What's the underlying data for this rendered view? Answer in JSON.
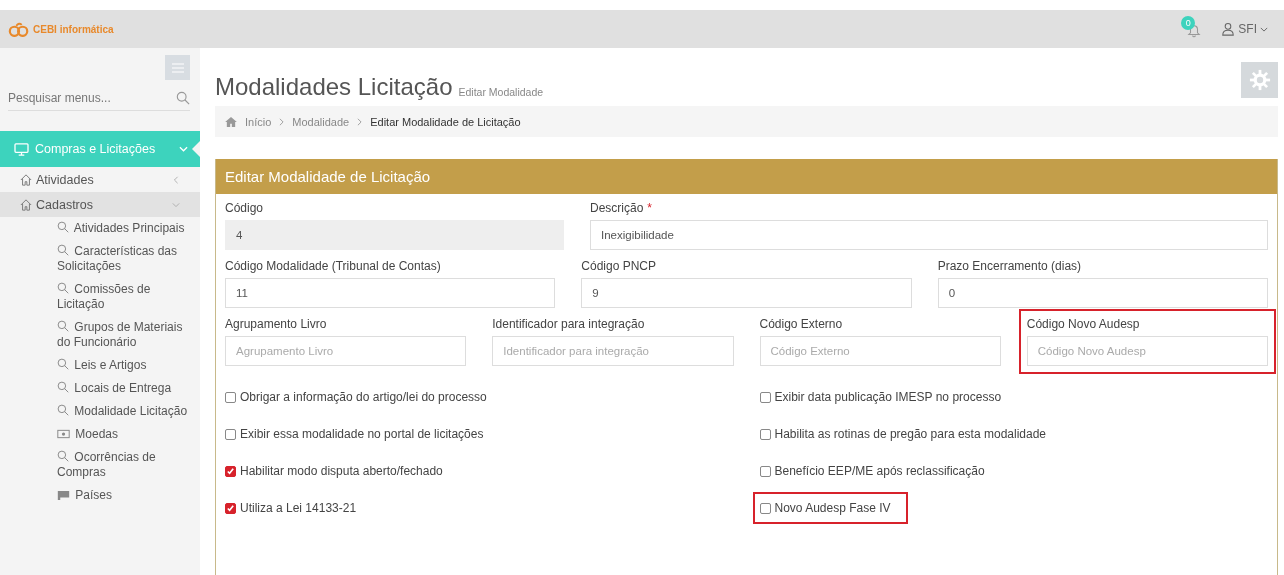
{
  "header": {
    "brand": "CEBI informática",
    "notifications": {
      "count": "0"
    },
    "user": {
      "name": "SFI"
    }
  },
  "sidebar": {
    "search": {
      "placeholder": "Pesquisar menus..."
    },
    "active_module": {
      "label": "Compras e Licitações",
      "expanded": true
    },
    "items": [
      {
        "label": "Atividades",
        "expanded": false,
        "selected": false
      },
      {
        "label": "Cadastros",
        "expanded": true,
        "selected": true,
        "children": [
          {
            "label": "Atividades Principais",
            "kind": "search"
          },
          {
            "label": "Características das Solicitações",
            "kind": "search"
          },
          {
            "label": "Comissões de Licitação",
            "kind": "search"
          },
          {
            "label": "Grupos de Materiais do Funcionário",
            "kind": "search"
          },
          {
            "label": "Leis e Artigos",
            "kind": "search"
          },
          {
            "label": "Locais de Entrega",
            "kind": "search"
          },
          {
            "label": "Modalidade Licitação",
            "kind": "search"
          },
          {
            "label": "Moedas",
            "kind": "cash"
          },
          {
            "label": "Ocorrências de Compras",
            "kind": "search"
          },
          {
            "label": "Países",
            "kind": "flag"
          }
        ]
      }
    ]
  },
  "page": {
    "title": "Modalidades Licitação",
    "subtitle": "Editar Modalidade",
    "breadcrumb": [
      "Início",
      "Modalidade",
      "Editar Modalidade de Licitação"
    ]
  },
  "panel": {
    "title": "Editar Modalidade de Licitação",
    "field_rows": [
      [
        {
          "label": "Código",
          "value": "4",
          "disabled": true
        },
        {
          "label": "Descrição",
          "required_mark": "*",
          "value": "Inexigibilidade",
          "disabled": false
        }
      ],
      [
        {
          "label": "Código Modalidade (Tribunal de Contas)",
          "value": "11",
          "disabled": false
        },
        {
          "label": "Código PNCP",
          "value": "9",
          "disabled": false
        },
        {
          "label": "Prazo Encerramento (dias)",
          "value": "0",
          "disabled": false
        }
      ],
      [
        {
          "label": "Agrupamento Livro",
          "placeholder": "Agrupamento Livro",
          "disabled": false
        },
        {
          "label": "Identificador para integração",
          "placeholder": "Identificador para integração",
          "disabled": false
        },
        {
          "label": "Código Externo",
          "placeholder": "Código Externo",
          "disabled": false
        },
        {
          "label": "Código Novo Audesp",
          "placeholder": "Código Novo Audesp",
          "disabled": false,
          "highlighted": true
        }
      ]
    ],
    "checkbox_columns": [
      [
        {
          "label": "Obrigar a informação do artigo/lei do processo",
          "checked": false,
          "highlighted": false
        },
        {
          "label": "Exibir essa modalidade no portal de licitações",
          "checked": false,
          "highlighted": false
        },
        {
          "label": "Habilitar modo disputa aberto/fechado",
          "checked": true,
          "highlighted": false
        },
        {
          "label": "Utiliza a Lei 14133-21",
          "checked": true,
          "highlighted": false
        }
      ],
      [
        {
          "label": "Exibir data publicação IMESP no processo",
          "checked": false,
          "highlighted": false
        },
        {
          "label": "Habilita as rotinas de pregão para esta modalidade",
          "checked": false,
          "highlighted": false
        },
        {
          "label": "Benefício EEP/ME após reclassificação",
          "checked": false,
          "highlighted": false
        },
        {
          "label": "Novo Audesp Fase IV",
          "checked": false,
          "highlighted": true
        }
      ]
    ]
  }
}
